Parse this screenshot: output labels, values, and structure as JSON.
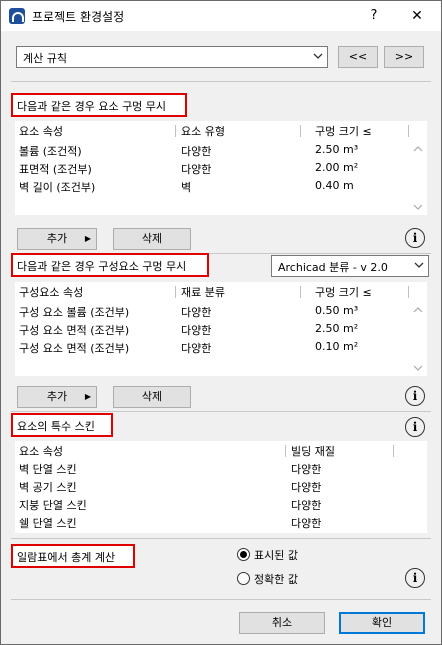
{
  "window": {
    "title": "프로젝트 환경설정",
    "help": "?",
    "close": "✕"
  },
  "top": {
    "selected": "계산 규칙",
    "prev": "<<",
    "next": ">>"
  },
  "section1": {
    "title": "다음과 같은 경우 요소 구멍 무시",
    "headers": [
      "요소 속성",
      "요소 유형",
      "구멍 크기 ≤"
    ],
    "rows": [
      [
        "볼륨 (조건적)",
        "다양한",
        "2.50 m³"
      ],
      [
        "표면적 (조건부)",
        "다양한",
        "2.00 m²"
      ],
      [
        "벽 길이 (조건부)",
        "벽",
        "0.40 m"
      ]
    ],
    "add": "추가",
    "delete": "삭제"
  },
  "section2": {
    "title": "다음과 같은 경우 구성요소 구멍 무시",
    "classification": "Archicad 분류 - v 2.0",
    "headers": [
      "구성요소 속성",
      "재료 분류",
      "구멍 크기 ≤"
    ],
    "rows": [
      [
        "구성 요소 볼륨 (조건부)",
        "다양한",
        "0.50 m³"
      ],
      [
        "구성 요소 면적 (조건부)",
        "다양한",
        "2.50 m²"
      ],
      [
        "구성 요소 면적 (조건부)",
        "다양한",
        "0.10 m²"
      ]
    ],
    "add": "추가",
    "delete": "삭제"
  },
  "section3": {
    "title": "요소의 특수 스킨",
    "headers": [
      "요소 속성",
      "빌딩 재질"
    ],
    "rows": [
      [
        "벽 단열 스킨",
        "다양한"
      ],
      [
        "벽 공기 스킨",
        "다양한"
      ],
      [
        "지붕 단열 스킨",
        "다양한"
      ],
      [
        "쉘 단열 스킨",
        "다양한"
      ]
    ]
  },
  "section4": {
    "title": "일람표에서 총계 계산",
    "option_displayed": "표시된 값",
    "option_exact": "정확한 값",
    "selected": "displayed"
  },
  "footer": {
    "cancel": "취소",
    "ok": "확인"
  },
  "info_label": "i"
}
